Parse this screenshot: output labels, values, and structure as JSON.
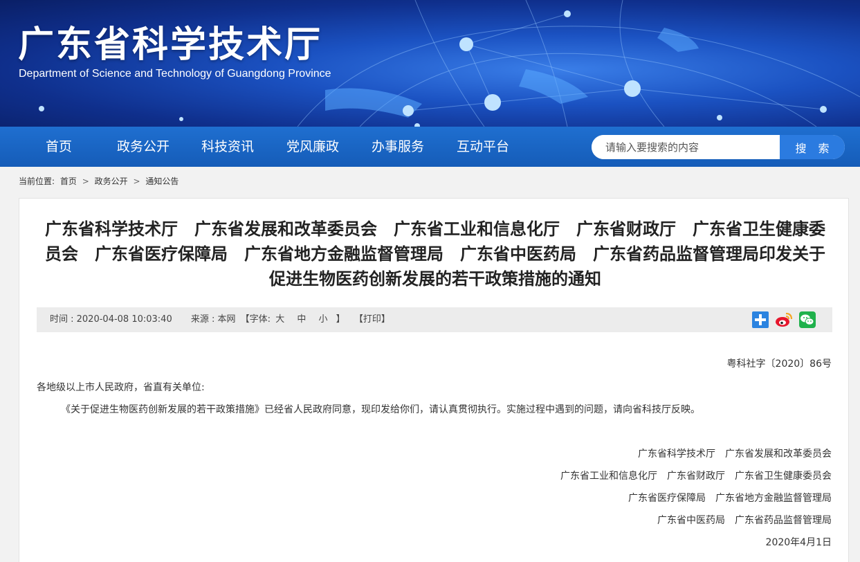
{
  "header": {
    "title": "广东省科学技术厅",
    "subtitle": "Department of Science and Technology of Guangdong Province"
  },
  "nav": {
    "items": [
      "首页",
      "政务公开",
      "科技资讯",
      "党风廉政",
      "办事服务",
      "互动平台"
    ]
  },
  "search": {
    "placeholder": "请输入要搜索的内容",
    "button_label": "搜 索"
  },
  "breadcrumb": {
    "label": "当前位置:",
    "items": [
      "首页",
      "政务公开",
      "通知公告"
    ],
    "separator": ">"
  },
  "article": {
    "title": "广东省科学技术厅　广东省发展和改革委员会　广东省工业和信息化厅　广东省财政厅　广东省卫生健康委员会　广东省医疗保障局　广东省地方金融监督管理局　广东省中医药局　广东省药品监督管理局印发关于促进生物医药创新发展的若干政策措施的通知",
    "meta": {
      "time_label": "时间 : 2020-04-08 10:03:40",
      "source_label": "来源 : 本网",
      "font_label": "【字体:",
      "font_large": "大",
      "font_medium": "中",
      "font_small": "小",
      "font_close": "】",
      "print_label": "【打印】"
    },
    "doc_number": "粤科社字〔2020〕86号",
    "salutation": "各地级以上市人民政府，省直有关单位:",
    "paragraph": "《关于促进生物医药创新发展的若干政策措施》已经省人民政府同意，现印发给你们，请认真贯彻执行。实施过程中遇到的问题，请向省科技厅反映。",
    "signatories": [
      "广东省科学技术厅　广东省发展和改革委员会",
      "广东省工业和信息化厅　广东省财政厅　广东省卫生健康委员会",
      "广东省医疗保障局　广东省地方金融监督管理局",
      "广东省中医药局　广东省药品监督管理局"
    ],
    "date": "2020年4月1日"
  },
  "colors": {
    "nav_bg": "#1a66c8",
    "search_button": "#2b7be0",
    "page_bg": "#f2f2f2",
    "meta_bar": "#ececec"
  },
  "icons": [
    "share-plus-icon",
    "weibo-icon",
    "wechat-icon"
  ]
}
